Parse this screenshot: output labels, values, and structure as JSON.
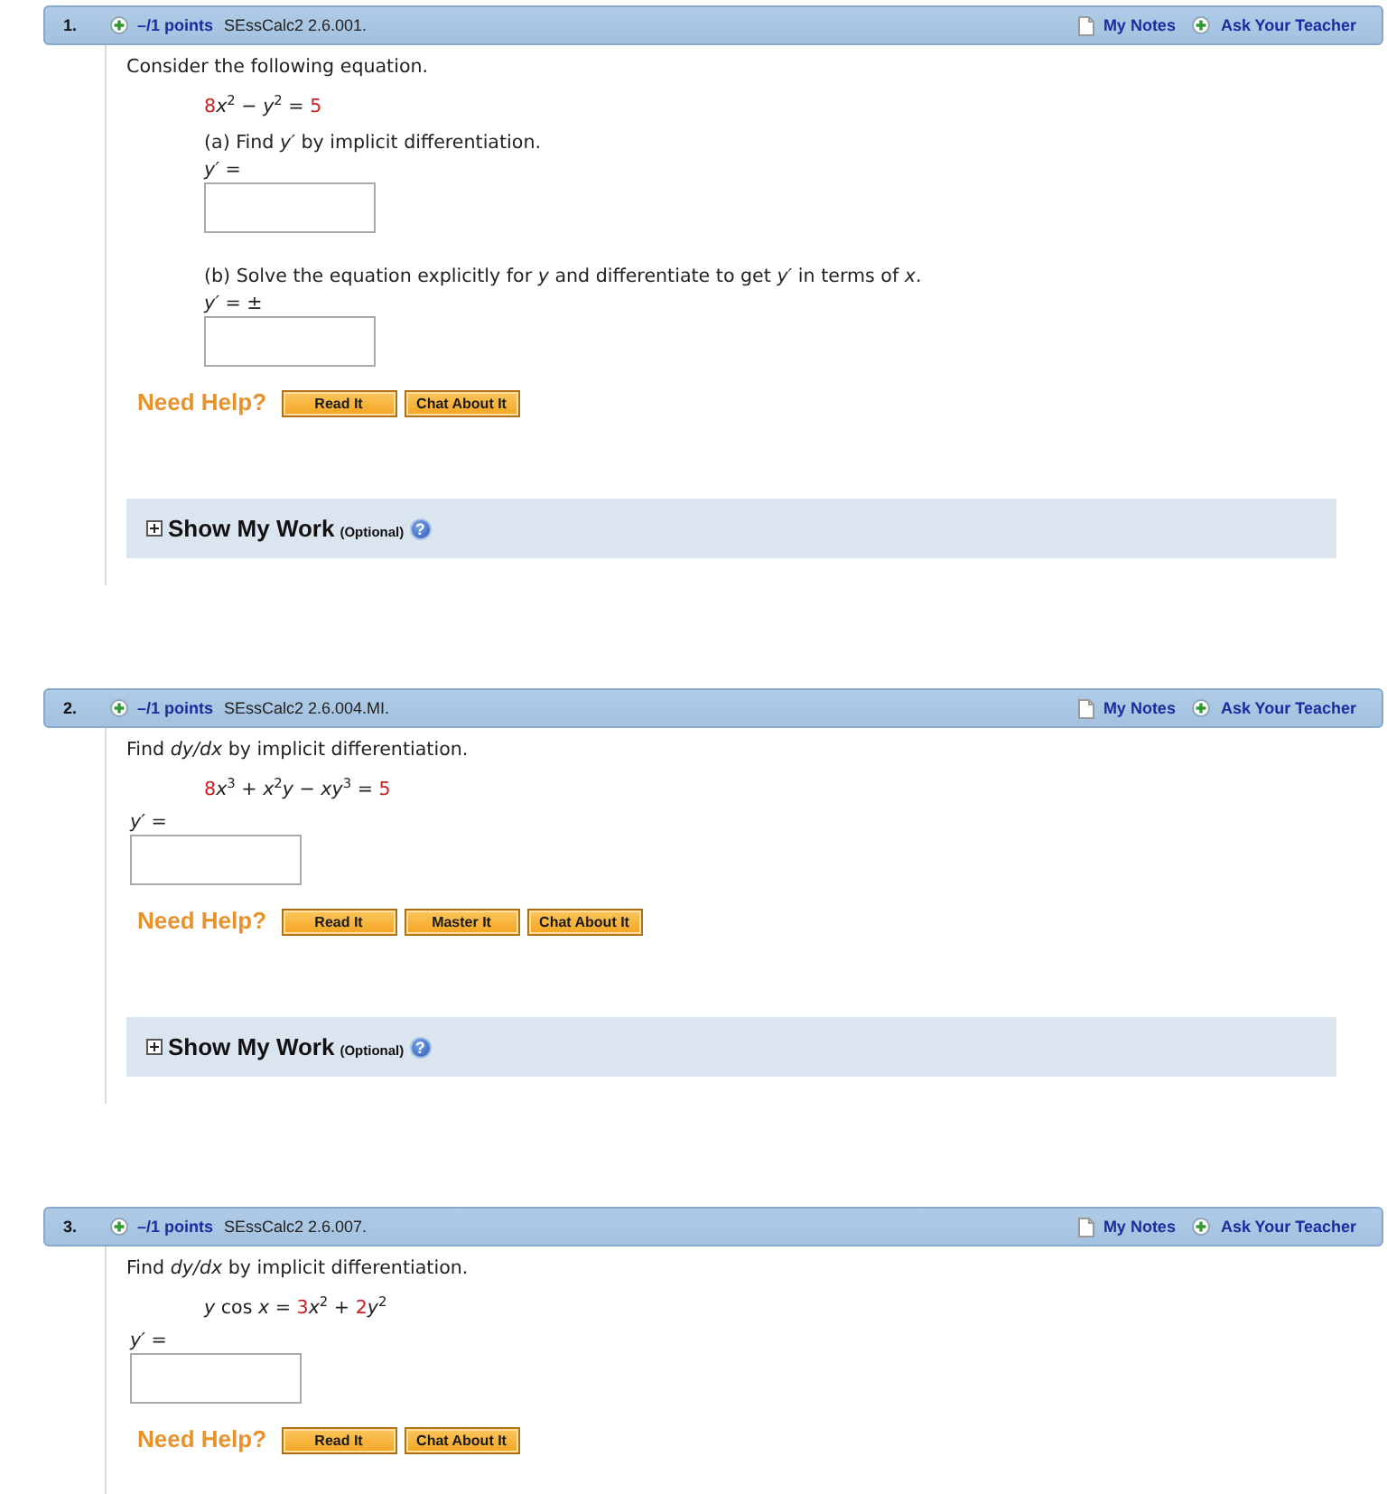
{
  "questions": [
    {
      "number": "1.",
      "points": "–/1 points",
      "source": "SEssCalc2 2.6.001.",
      "notes_link": "My Notes",
      "ask_link": "Ask Your Teacher",
      "prompt": "Consider the following equation.",
      "equation": [
        {
          "text": "8",
          "highlighted": true
        },
        {
          "text": "*x*$^{2}$ − *y*$^{2}$ = ",
          "highlighted": false
        },
        {
          "text": "5",
          "highlighted": true
        }
      ],
      "answers": [
        {
          "kind": "part",
          "text": "(a) Find *y′* by implicit differentiation.",
          "label": "*y′* ="
        },
        {
          "kind": "part",
          "text": "(b) Solve the equation explicitly for *y* and differentiate to get *y′* in terms of *x*.",
          "label": "*y′* = ±"
        }
      ],
      "help": {
        "label": "Need Help?",
        "buttons": [
          "Read It",
          "Chat About It"
        ]
      },
      "show_work": {
        "label": "Show My Work",
        "note": "(Optional)",
        "help_symbol": "?",
        "expanded": false
      }
    },
    {
      "number": "2.",
      "points": "–/1 points",
      "source": "SEssCalc2 2.6.004.MI.",
      "notes_link": "My Notes",
      "ask_link": "Ask Your Teacher",
      "prompt": "Find *dy/dx* by implicit differentiation.",
      "equation": [
        {
          "text": "8",
          "highlighted": true
        },
        {
          "text": "*x*$^{3}$ + *x*$^{2}$*y* − *xy*$^{3}$ = ",
          "highlighted": false
        },
        {
          "text": "5",
          "highlighted": true
        }
      ],
      "answers": [
        {
          "kind": "single",
          "label": "*y′* ="
        }
      ],
      "help": {
        "label": "Need Help?",
        "buttons": [
          "Read It",
          "Master It",
          "Chat About It"
        ]
      },
      "show_work": {
        "label": "Show My Work",
        "note": "(Optional)",
        "help_symbol": "?",
        "expanded": false
      }
    },
    {
      "number": "3.",
      "points": "–/1 points",
      "source": "SEssCalc2 2.6.007.",
      "notes_link": "My Notes",
      "ask_link": "Ask Your Teacher",
      "prompt": "Find *dy/dx* by implicit differentiation.",
      "equation": [
        {
          "text": "*y* cos *x* = ",
          "highlighted": false
        },
        {
          "text": "3",
          "highlighted": true
        },
        {
          "text": "*x*$^{2}$ + ",
          "highlighted": false
        },
        {
          "text": "2",
          "highlighted": true
        },
        {
          "text": "*y*$^{2}$",
          "highlighted": false
        }
      ],
      "answers": [
        {
          "kind": "single",
          "label": "*y′* ="
        }
      ],
      "help": {
        "label": "Need Help?",
        "buttons": [
          "Read It",
          "Chat About It"
        ]
      }
    }
  ]
}
